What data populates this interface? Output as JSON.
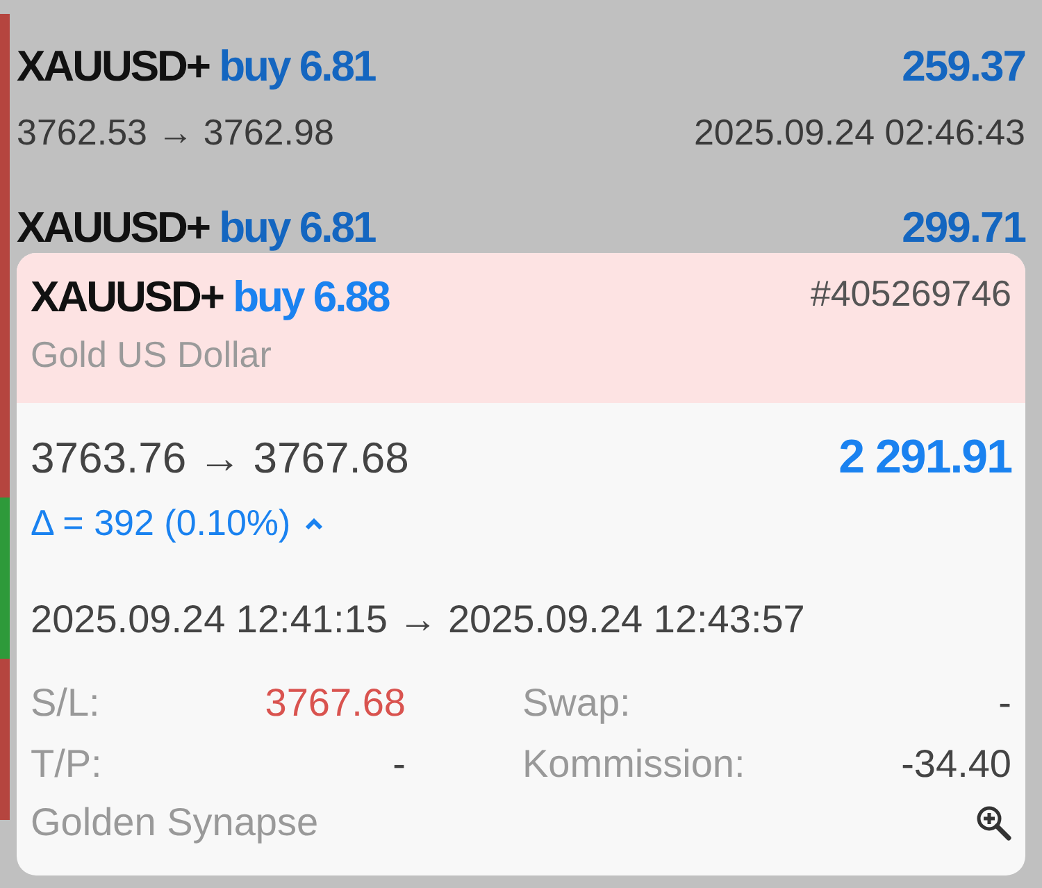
{
  "trades": [
    {
      "symbol": "XAUUSD+",
      "side": "buy",
      "volume": "6.81",
      "profit": "259.37",
      "prices": "3762.53 → 3762.98",
      "time": "2025.09.24 02:46:43",
      "color": "#b5453f"
    },
    {
      "symbol": "XAUUSD+",
      "side": "buy",
      "volume": "6.81",
      "profit": "299.71",
      "color": "#b5453f"
    },
    {
      "color": "#b5453f"
    },
    {
      "color": "#2e9a3a"
    },
    {
      "color": "#b5453f"
    }
  ],
  "detail": {
    "symbol": "XAUUSD+",
    "side": "buy",
    "volume": "6.88",
    "ticket": "#405269746",
    "description": "Gold US Dollar",
    "prices": "3763.76 → 3767.68",
    "profit": "2 291.91",
    "delta": "Δ = 392 (0.10%)",
    "expanded": true,
    "times": "2025.09.24 12:41:15 → 2025.09.24 12:43:57",
    "fields": [
      {
        "label": "S/L:",
        "value": "3767.68",
        "kind": "alert"
      },
      {
        "label": "Swap:",
        "value": "-",
        "kind": "plain"
      },
      {
        "label": "T/P:",
        "value": "-",
        "kind": "plain"
      },
      {
        "label": "Kommission:",
        "value": "-34.40",
        "kind": "plain"
      }
    ],
    "comment": "Golden Synapse"
  }
}
